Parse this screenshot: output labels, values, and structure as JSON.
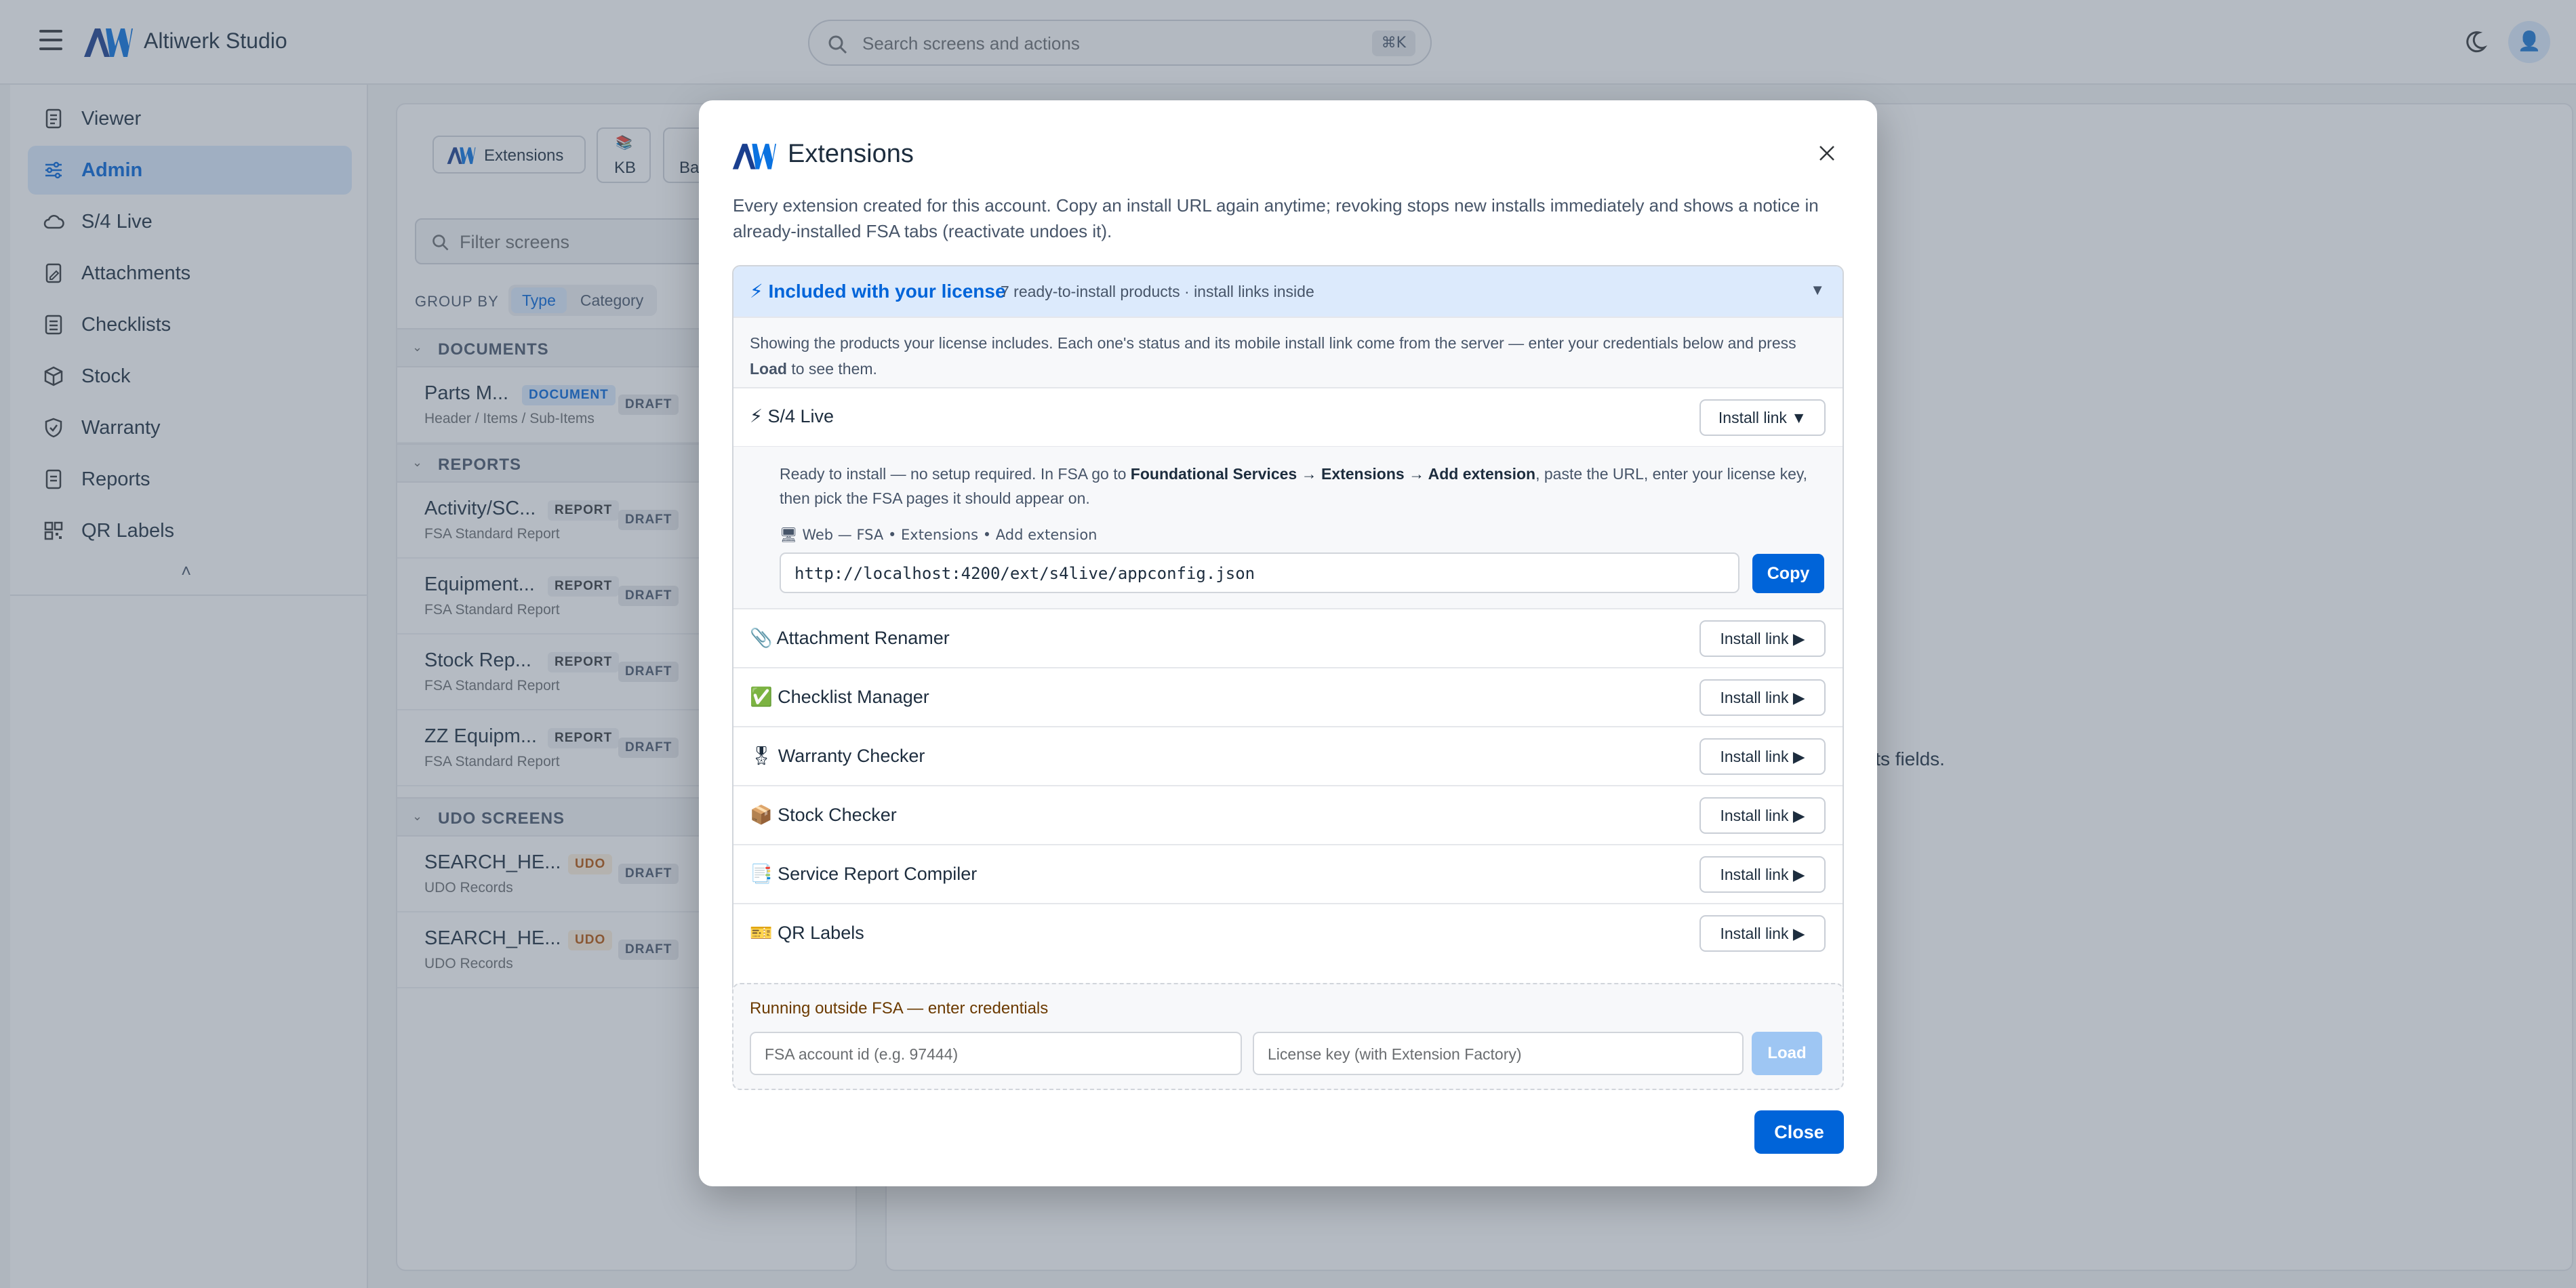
{
  "app": {
    "title": "Altiwerk Studio"
  },
  "search": {
    "placeholder": "Search screens and actions",
    "shortcut": "⌘K"
  },
  "sidebar": {
    "items": [
      {
        "label": "Viewer",
        "icon": "document-icon"
      },
      {
        "label": "Admin",
        "icon": "sliders-icon",
        "active": true
      },
      {
        "label": "S/4 Live",
        "icon": "cloud-icon"
      },
      {
        "label": "Attachments",
        "icon": "file-edit-icon"
      },
      {
        "label": "Checklists",
        "icon": "checklist-icon"
      },
      {
        "label": "Stock",
        "icon": "box-icon"
      },
      {
        "label": "Warranty",
        "icon": "shield-icon"
      },
      {
        "label": "Reports",
        "icon": "report-icon"
      },
      {
        "label": "QR Labels",
        "icon": "qr-icon"
      }
    ],
    "collapse_glyph": "˄"
  },
  "background": {
    "chips": {
      "extensions": "Extensions",
      "kb_icon": "📚",
      "kb": "KB",
      "third": "Ba"
    },
    "filter_placeholder": "Filter screens",
    "group_by": {
      "label": "GROUP BY",
      "options": [
        "Type",
        "Category"
      ],
      "selected": "Type"
    },
    "sections": [
      {
        "title": "DOCUMENTS",
        "rows": [
          {
            "name": "Parts M...",
            "sub": "Header / Items / Sub-Items",
            "badge": "DOCUMENT",
            "status": "DRAFT"
          }
        ]
      },
      {
        "title": "REPORTS",
        "rows": [
          {
            "name": "Activity/SC...",
            "sub": "FSA Standard Report",
            "badge": "REPORT",
            "status": "DRAFT"
          },
          {
            "name": "Equipment...",
            "sub": "FSA Standard Report",
            "badge": "REPORT",
            "status": "DRAFT"
          },
          {
            "name": "Stock Rep...",
            "sub": "FSA Standard Report",
            "badge": "REPORT",
            "status": "DRAFT"
          },
          {
            "name": "ZZ Equipm...",
            "sub": "FSA Standard Report",
            "badge": "REPORT",
            "status": "DRAFT"
          }
        ]
      },
      {
        "title": "UDO SCREENS",
        "rows": [
          {
            "name": "SEARCH_HE...",
            "sub": "UDO Records",
            "badge": "UDO",
            "status": "DRAFT"
          },
          {
            "name": "SEARCH_HE...",
            "sub": "UDO Records",
            "badge": "UDO",
            "status": "DRAFT"
          }
        ]
      }
    ],
    "main_hint": "its fields."
  },
  "modal": {
    "title": "Extensions",
    "description": "Every extension created for this account. Copy an install URL again anytime; revoking stops new installs immediately and shows a notice in already-installed FSA tabs (reactivate undoes it).",
    "accordion": {
      "icon": "⚡",
      "title": "Included with your license",
      "subtitle": "7 ready-to-install products · install links inside",
      "toggle": "▼",
      "intro_prefix": "Showing the products your license includes. Each one's status and its mobile install link come from the server — enter your credentials below and press ",
      "intro_bold": "Load",
      "intro_suffix": " to see them."
    },
    "products": [
      {
        "icon": "⚡",
        "name": "S/4 Live",
        "button": "Install link ▼",
        "expanded": true
      },
      {
        "icon": "📎",
        "name": "Attachment Renamer",
        "button": "Install link ▶"
      },
      {
        "icon": "✅",
        "name": "Checklist Manager",
        "button": "Install link ▶"
      },
      {
        "icon": "🎖",
        "name": "Warranty Checker",
        "button": "Install link ▶"
      },
      {
        "icon": "📦",
        "name": "Stock Checker",
        "button": "Install link ▶"
      },
      {
        "icon": "📑",
        "name": "Service Report Compiler",
        "button": "Install link ▶"
      },
      {
        "icon": "🎫",
        "name": "QR Labels",
        "button": "Install link ▶"
      }
    ],
    "expanded": {
      "ready_prefix": "Ready to install — no setup required. In FSA go to ",
      "ready_bold": "Foundational Services → Extensions → Add extension",
      "ready_suffix": ", paste the URL, enter your license key, then pick the FSA pages it should appear on.",
      "target": "🖥 Web — FSA • Extensions • Add extension",
      "url": "http://localhost:4200/ext/s4live/appconfig.json",
      "copy": "Copy"
    },
    "credentials": {
      "heading": "Running outside FSA — enter credentials",
      "account_placeholder": "FSA account id (e.g. 97444)",
      "license_placeholder": "License key (with Extension Factory)",
      "load": "Load"
    },
    "close": "Close"
  },
  "colors": {
    "accent": "#0064d9",
    "accordion_bg": "#dceafc",
    "overlay": "#4e5c70"
  }
}
